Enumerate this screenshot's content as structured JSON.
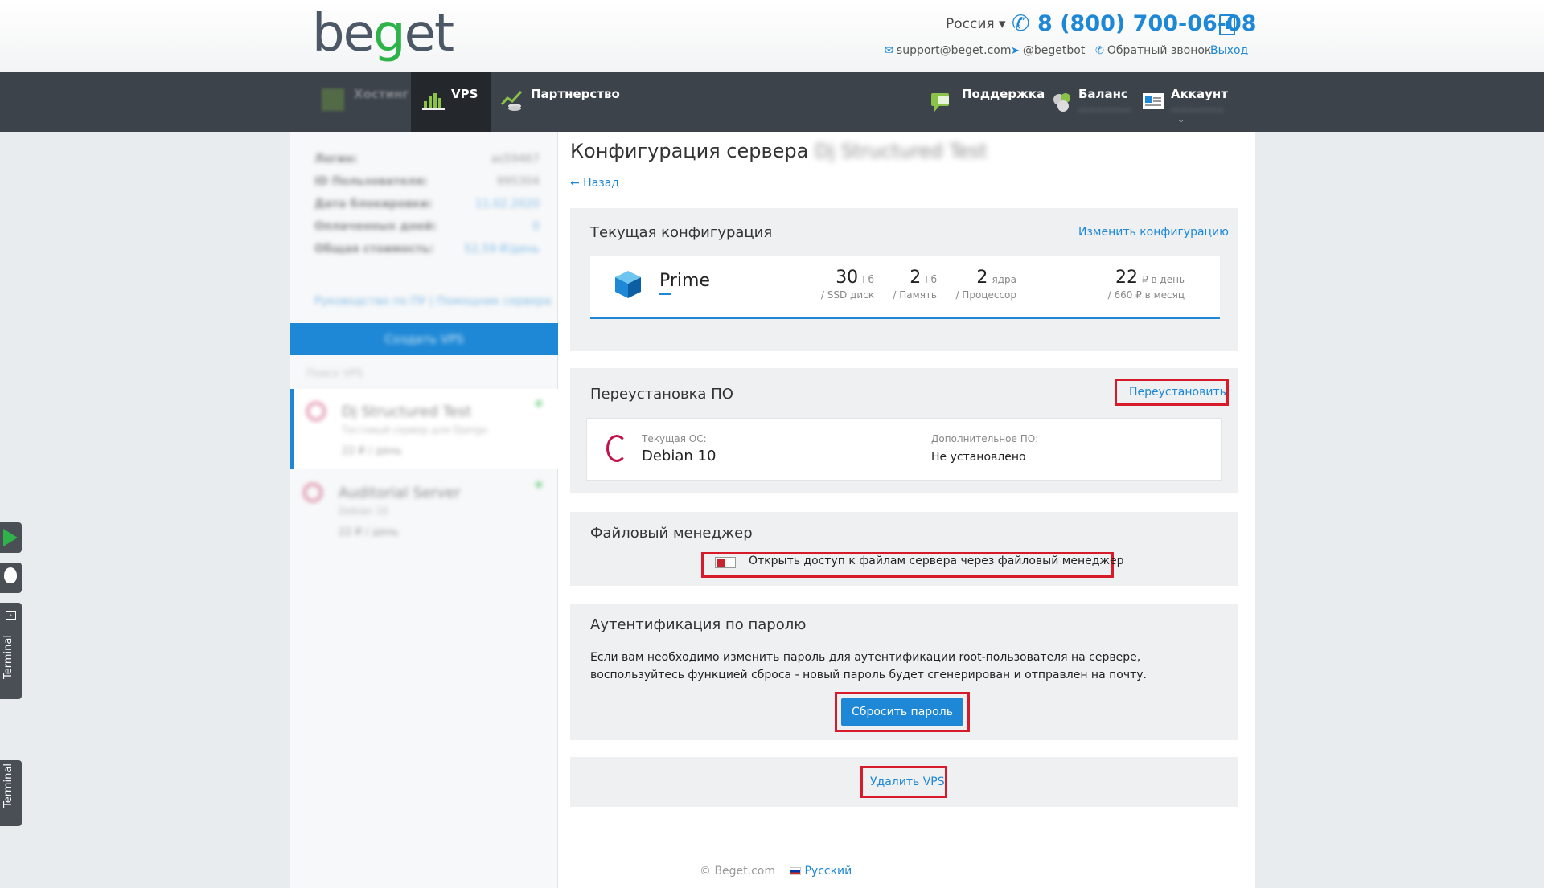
{
  "header": {
    "logo_text": "beget",
    "region": "Россия ▾",
    "phone": "8 (800) 700-06-08",
    "email": "support@beget.com",
    "telegram": "@begetbot",
    "callback": "Обратный звонок",
    "logout": "Выход"
  },
  "nav": {
    "domains_label": "Хостинг",
    "vps_label": "VPS",
    "partner_label": "Партнерство",
    "support_label": "Поддержка",
    "balance_label": "Баланс",
    "account_label": "Аккаунт"
  },
  "sidebar": {
    "stats": [
      {
        "label": "Логин:",
        "value": "as59467"
      },
      {
        "label": "ID Пользователя:",
        "value": "995304"
      },
      {
        "label": "Дата блокировки:",
        "value": "11.02.2020"
      },
      {
        "label": "Оплаченных дней:",
        "value": "0"
      },
      {
        "label": "Общая стоимость:",
        "value": "52,59 ₽/день"
      }
    ],
    "guide_link": "Руководство по ПУ | Помощник сервера",
    "create_vps": "Создать VPS",
    "search_placeholder": "Поиск VPS",
    "servers": [
      {
        "name": "Dj Structured Test",
        "sub": "Тестовый сервер для Django",
        "price": "22 ₽ / день"
      },
      {
        "name": "Auditorial Server",
        "sub": "Debian 10",
        "price": "22 ₽ / день"
      }
    ]
  },
  "page": {
    "title": "Конфигурация сервера",
    "server_name": "Dj Structured Test",
    "back": "← Назад"
  },
  "config": {
    "title": "Текущая конфигурация",
    "change_link": "Изменить конфигурацию",
    "plan": "Prime",
    "ssd_value": "30",
    "ssd_unit": "Гб",
    "ssd_caption": "/ SSD диск",
    "ram_value": "2",
    "ram_unit": "Гб",
    "ram_caption": "/ Память",
    "cpu_value": "2",
    "cpu_unit": "ядра",
    "cpu_caption": "/ Процессор",
    "price_value": "22",
    "price_unit": "₽ в день",
    "price_caption": "/ 660 ₽ в месяц"
  },
  "reinstall": {
    "title": "Переустановка ПО",
    "link": "Переустановить",
    "current_os_label": "Текущая ОС:",
    "current_os_value": "Debian 10",
    "extra_label": "Дополнительное ПО:",
    "extra_value": "Не установлено"
  },
  "file_manager": {
    "title": "Файловый менеджер",
    "toggle_text": "Открыть доступ к файлам сервера через файловый менеджер"
  },
  "auth": {
    "title": "Аутентификация по паролю",
    "description": "Если вам необходимо изменить пароль для аутентификации root-пользователя на сервере, воспользуйтесь функцией сброса - новый пароль будет сгенерирован и отправлен на почту.",
    "reset_button": "Сбросить пароль"
  },
  "delete": {
    "link": "Удалить VPS"
  },
  "footer": {
    "copyright": "© Beget.com",
    "language": "Русский"
  },
  "floating": {
    "terminal_label": "Terminal"
  },
  "colors": {
    "accent": "#1e88d6",
    "nav_bg": "#3d434b",
    "highlight_frame": "#d81b2a",
    "brand_green": "#2db34a"
  }
}
